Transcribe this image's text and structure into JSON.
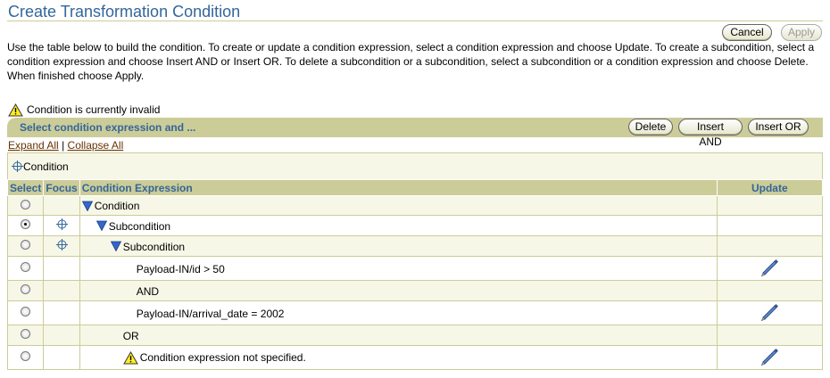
{
  "page": {
    "title": "Create Transformation Condition",
    "instructions": "Use the table below to build the condition. To create or update a condition expression, select a condition expression and choose Update. To create a subcondition, select a condition expression and choose Insert AND or Insert OR. To delete a subcondition or a subcondition, select a subcondition or a condition expression and choose Delete. When finished choose Apply."
  },
  "buttons": {
    "cancel": "Cancel",
    "apply": "Apply",
    "delete": "Delete",
    "insert_and": "Insert AND",
    "insert_or": "Insert OR"
  },
  "status": {
    "warning": "Condition is currently invalid"
  },
  "header_bar": {
    "label": "Select condition expression and ..."
  },
  "links": {
    "expand_all": "Expand All",
    "separator": "|",
    "collapse_all": "Collapse All"
  },
  "focus": {
    "label": "Condition"
  },
  "table": {
    "headers": {
      "select": "Select",
      "focus": "Focus",
      "expression": "Condition Expression",
      "update": "Update"
    },
    "rows": [
      {
        "text": "Condition",
        "level": 0,
        "type": "node",
        "selected": false,
        "focus": false,
        "update": false
      },
      {
        "text": "Subcondition",
        "level": 1,
        "type": "node",
        "selected": true,
        "focus": true,
        "update": false
      },
      {
        "text": "Subcondition",
        "level": 2,
        "type": "node",
        "selected": false,
        "focus": true,
        "update": false
      },
      {
        "text": "Payload-IN/id > 50",
        "level": 4,
        "type": "expr",
        "selected": false,
        "focus": false,
        "update": true
      },
      {
        "text": "AND",
        "level": 4,
        "type": "op",
        "selected": false,
        "focus": false,
        "update": false
      },
      {
        "text": "Payload-IN/arrival_date = 2002",
        "level": 4,
        "type": "expr",
        "selected": false,
        "focus": false,
        "update": true
      },
      {
        "text": "OR",
        "level": 3,
        "type": "op",
        "selected": false,
        "focus": false,
        "update": false
      },
      {
        "text": "Condition expression not specified.",
        "level": 3,
        "type": "warn",
        "selected": false,
        "focus": false,
        "update": true
      }
    ]
  },
  "colors": {
    "title": "#336699",
    "bar": "#cccc99",
    "row_shade": "#f7f7e7",
    "link": "#663300"
  },
  "icons": {
    "warning": "warning-icon",
    "focus": "crosshair-icon",
    "expand": "triangle-down-icon",
    "update": "pencil-icon"
  }
}
